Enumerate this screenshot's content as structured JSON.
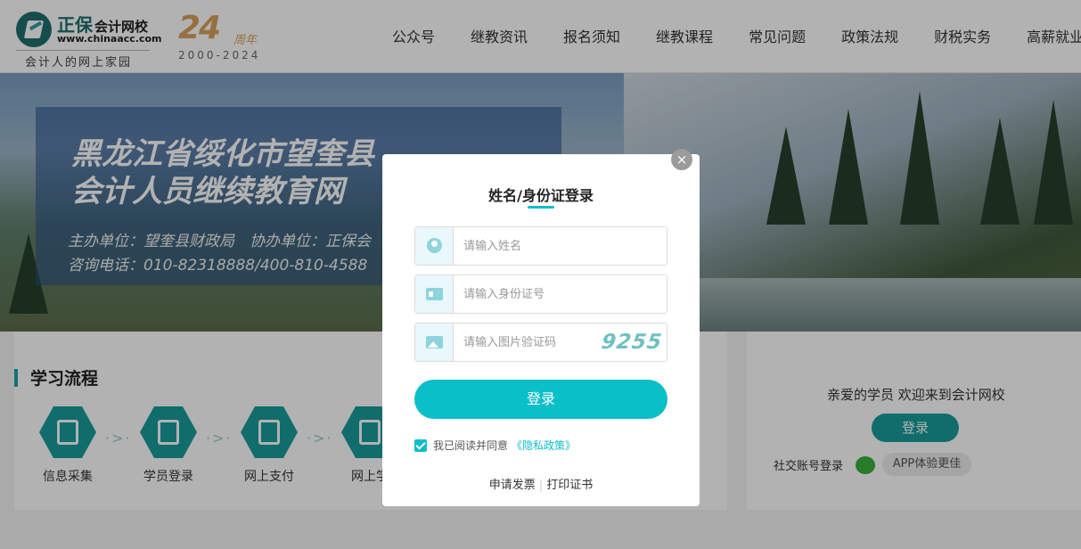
{
  "header": {
    "logo_brand": "正保",
    "logo_name": "会计网校",
    "logo_url": "www.chinaacc.com",
    "logo_slogan": "会计人的网上家园",
    "anniversary_number": "24",
    "anniversary_suffix": "周年",
    "anniversary_years": "2000-2024",
    "nav": [
      "公众号",
      "继教资讯",
      "报名须知",
      "继教课程",
      "常见问题",
      "政策法规",
      "财税实务",
      "高薪就业"
    ]
  },
  "banner": {
    "title_line1": "黑龙江省绥化市望奎县",
    "title_line2": "会计人员继续教育网",
    "sub_line1": "主办单位：望奎县财政局　协办单位：正保会",
    "sub_line2": "咨询电话：010-82318888/400-810-4588"
  },
  "study": {
    "title": "学习流程",
    "steps": [
      "信息采集",
      "学员登录",
      "网上支付",
      "网上学"
    ],
    "arrow": "·>·"
  },
  "welcome": {
    "text": "亲爱的学员 欢迎来到会计网校",
    "login_label": "登录",
    "social_label": "社交账号登录",
    "app_label": "APP体验更佳"
  },
  "modal": {
    "close_symbol": "×",
    "title": "姓名/身份证登录",
    "name_placeholder": "请输入姓名",
    "id_placeholder": "请输入身份证号",
    "captcha_placeholder": "请输入图片验证码",
    "captcha_text": "9255",
    "login_label": "登录",
    "agree_text": "我已阅读并同意",
    "privacy_label": "《隐私政策》",
    "invoice_label": "申请发票",
    "separator": "|",
    "certificate_label": "打印证书",
    "accent_color": "#0bbfc9"
  }
}
